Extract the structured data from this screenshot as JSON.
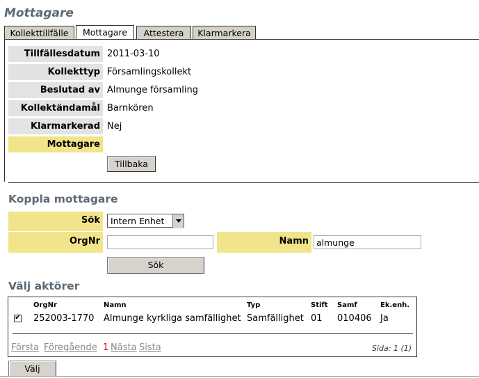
{
  "page": {
    "title": "Mottagare"
  },
  "tabs": [
    {
      "label": "Kollekttillfälle"
    },
    {
      "label": "Mottagare"
    },
    {
      "label": "Attestera"
    },
    {
      "label": "Klarmarkera"
    }
  ],
  "details": {
    "rows": [
      {
        "label": "Tillfällesdatum",
        "value": "2011-03-10"
      },
      {
        "label": "Kollekttyp",
        "value": "Församlingskollekt"
      },
      {
        "label": "Beslutad av",
        "value": "Almunge församling"
      },
      {
        "label": "Kollektändamål",
        "value": "Barnkören"
      },
      {
        "label": "Klarmarkerad",
        "value": "Nej"
      },
      {
        "label": "Mottagare",
        "value": ""
      }
    ],
    "back_button": "Tillbaka"
  },
  "koppla": {
    "title": "Koppla mottagare",
    "sok_label": "Sök",
    "sok_value": "Intern Enhet",
    "orgnr_label": "OrgNr",
    "orgnr_value": "",
    "namn_label": "Namn",
    "namn_value": "almunge",
    "search_button": "Sök"
  },
  "aktorer": {
    "title": "Välj aktörer",
    "columns": [
      "OrgNr",
      "Namn",
      "Typ",
      "Stift",
      "Samf",
      "Ek.enh."
    ],
    "rows": [
      {
        "checked": true,
        "orgnr": "252003-1770",
        "namn": "Almunge kyrkliga samfällighet",
        "typ": "Samfällighet",
        "stift": "01",
        "samf": "010406",
        "ekenh": "Ja"
      }
    ],
    "pager": {
      "first": "Första",
      "prev": "Föregående",
      "current": "1",
      "next": "Nästa",
      "last": "Sista",
      "page_info": "Sida: 1 (1)"
    },
    "select_button": "Välj"
  }
}
